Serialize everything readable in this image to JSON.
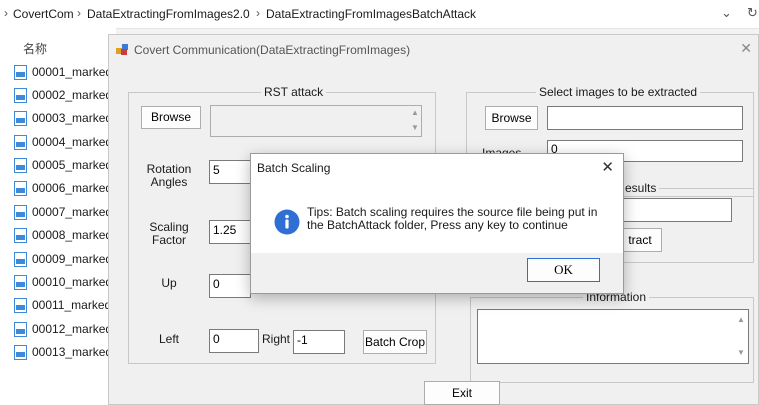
{
  "explorer": {
    "breadcrumb": [
      "CovertCom",
      "DataExtractingFromImages2.0",
      "DataExtractingFromImages",
      "BatchAttack"
    ],
    "column_header": "名称",
    "files": [
      "00001_marked",
      "00002_marked",
      "00003_marked",
      "00004_marked",
      "00005_marked",
      "00006_marked",
      "00007_marked",
      "00008_marked",
      "00009_marked",
      "00010_marked",
      "00011_marked",
      "00012_marked",
      "00013_marked"
    ]
  },
  "app": {
    "title": "Covert Communication(DataExtractingFromImages)",
    "rst": {
      "caption": "RST attack",
      "browse": "Browse",
      "rotation_label": "Rotation\nAngles",
      "rotation_value": "5",
      "scaling_label": "Scaling\nFactor",
      "scaling_value": "1.25",
      "up_label": "Up",
      "up_value": "0",
      "left_label": "Left",
      "left_value": "0",
      "right_label": "Right",
      "right_value": "-1",
      "batch_crop": "Batch Crop"
    },
    "select": {
      "caption": "Select images to be extracted",
      "browse": "Browse",
      "images_label": "Images",
      "images_value": "0"
    },
    "results": {
      "caption_partial": "esults",
      "extract_partial": "tract"
    },
    "information": {
      "caption": "Information"
    },
    "exit": "Exit"
  },
  "dialog": {
    "title": "Batch Scaling",
    "message": "Tips: Batch scaling requires the source file being put in the BatchAttack folder, Press any key to continue",
    "ok": "OK"
  }
}
